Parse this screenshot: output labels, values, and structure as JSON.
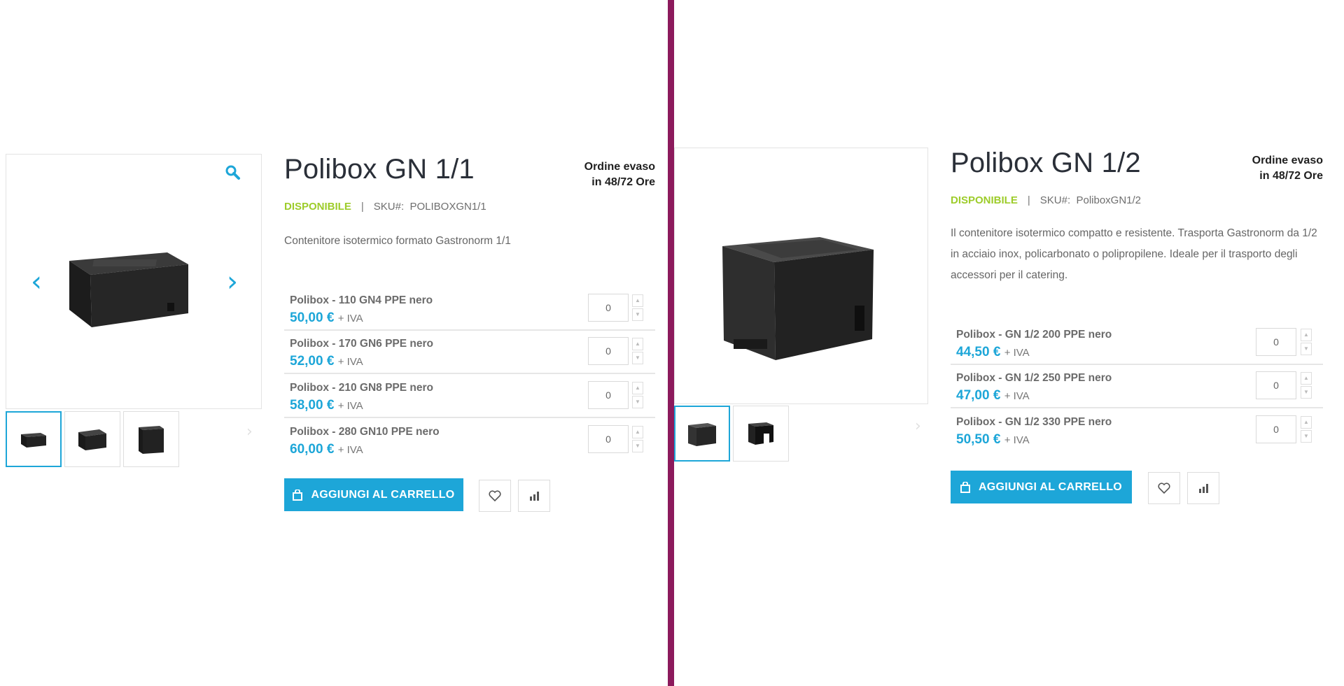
{
  "colors": {
    "accent": "#1da6d8",
    "available": "#9dcc2a",
    "divider": "#8c1a5c"
  },
  "products": [
    {
      "title": "Polibox GN 1/1",
      "shipping_line1": "Ordine evaso",
      "shipping_line2": "in 48/72 Ore",
      "availability": "DISPONIBILE",
      "separator": "|",
      "sku_label": "SKU#:",
      "sku": "POLIBOXGN1/1",
      "description": "Contenitore isotermico formato Gastronorm 1/1",
      "variants": [
        {
          "name": "Polibox - 110 GN4 PPE nero",
          "price": "50,00 €",
          "vat": "+ IVA",
          "qty": "0"
        },
        {
          "name": "Polibox - 170 GN6 PPE nero",
          "price": "52,00 €",
          "vat": "+ IVA",
          "qty": "0"
        },
        {
          "name": "Polibox - 210 GN8 PPE nero",
          "price": "58,00 €",
          "vat": "+ IVA",
          "qty": "0"
        },
        {
          "name": "Polibox - 280 GN10 PPE nero",
          "price": "60,00 €",
          "vat": "+ IVA",
          "qty": "0"
        }
      ],
      "add_to_cart": "AGGIUNGI AL CARRELLO"
    },
    {
      "title": "Polibox GN 1/2",
      "shipping_line1": "Ordine evaso",
      "shipping_line2": "in 48/72 Ore",
      "availability": "DISPONIBILE",
      "separator": "|",
      "sku_label": "SKU#:",
      "sku": "PoliboxGN1/2",
      "description": "Il contenitore isotermico compatto e resistente. Trasporta Gastronorm da 1/2 in acciaio inox, policarbonato o polipropilene. Ideale per il trasporto degli accessori per il catering.",
      "variants": [
        {
          "name": "Polibox - GN 1/2 200 PPE nero",
          "price": "44,50 €",
          "vat": "+ IVA",
          "qty": "0"
        },
        {
          "name": "Polibox - GN 1/2 250 PPE nero",
          "price": "47,00 €",
          "vat": "+ IVA",
          "qty": "0"
        },
        {
          "name": "Polibox - GN 1/2 330 PPE nero",
          "price": "50,50 €",
          "vat": "+ IVA",
          "qty": "0"
        }
      ],
      "add_to_cart": "AGGIUNGI AL CARRELLO"
    }
  ]
}
